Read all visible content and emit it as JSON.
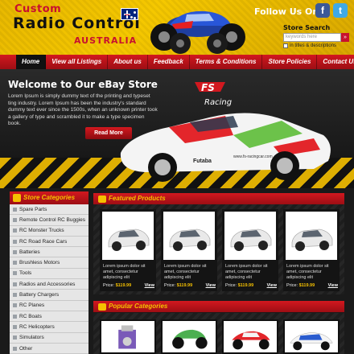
{
  "header": {
    "logo_line1": "Custom",
    "logo_line2": "Radio Control",
    "logo_line3": "AUSTRALIA",
    "follow_label": "Follow Us On:",
    "facebook_glyph": "f",
    "twitter_glyph": "t",
    "store_search": {
      "title": "Store Search",
      "placeholder": "keywords here",
      "button_glyph": "»",
      "checkbox_label": "in titles & descriptions"
    }
  },
  "nav": {
    "items": [
      "Home",
      "View all Listings",
      "About us",
      "Feedback",
      "Terms & Conditions",
      "Store Policies",
      "Contact Us"
    ],
    "active_index": 0
  },
  "banner": {
    "title": "Welcome to Our eBay Store",
    "text": "Lorem Ipsum is simply dummy text of the printing and typeset ting industry. Lorem Ipsum has been the industry's standard dummy text ever since the 1500s, when an unknown printer took a gallery of type and scrambled it to make a type specimen book.",
    "read_more": "Read More",
    "sponsor_logo": "FS",
    "sponsor_sub": "Racing",
    "car_brand": "Futaba",
    "car_url": "www.fs-racingcar.com"
  },
  "sidebar": {
    "title": "Store Categories",
    "items": [
      "Spare Parts",
      "Remote Control RC Buggies",
      "RC Monster Trucks",
      "RC Road Race Cars",
      "Batteries",
      "Brushless Motors",
      "Tools",
      "Radios and Accessories",
      "Battery Chargers",
      "RC Planes",
      "RC Boats",
      "RC Helicopters",
      "Simulators",
      "Other"
    ]
  },
  "featured": {
    "title": "Featured Products",
    "products": [
      {
        "desc": "Lorem ipsum dolor sit amet, consectetur adipiscing elit",
        "price_label": "Price:",
        "price": "$119.99",
        "view": "View"
      },
      {
        "desc": "Lorem ipsum dolor sit amet, consectetur adipiscing elit",
        "price_label": "Price:",
        "price": "$119.99",
        "view": "View"
      },
      {
        "desc": "Lorem ipsum dolor sit amet, consectetur adipiscing elit",
        "price_label": "Price:",
        "price": "$119.99",
        "view": "View"
      },
      {
        "desc": "Lorem ipsum dolor sit amet, consectetur adipiscing elit",
        "price_label": "Price:",
        "price": "$119.99",
        "view": "View"
      }
    ]
  },
  "popular": {
    "title": "Popular Categories"
  },
  "colors": {
    "brand_red": "#d2181f",
    "brand_yellow": "#f5c000",
    "dark_bg": "#1a1a1a"
  }
}
